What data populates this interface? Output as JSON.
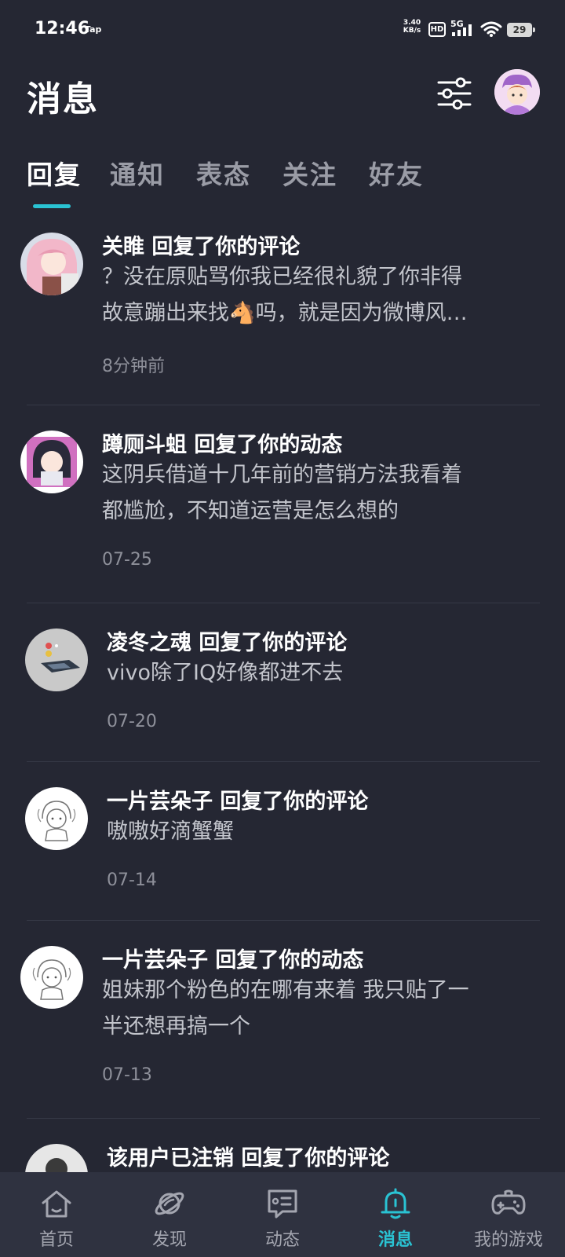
{
  "status_bar": {
    "time": "12:46",
    "tap_label": "Tap",
    "net_speed_top": "3.40",
    "net_speed_bottom": "KB/s",
    "hd_badge": "HD",
    "signal_label": "5G",
    "battery_level": "29"
  },
  "header": {
    "title": "消息",
    "filter_icon": "sliders-icon",
    "avatar_icon": "user-avatar"
  },
  "tabs": [
    {
      "label": "回复",
      "active": true
    },
    {
      "label": "通知",
      "active": false
    },
    {
      "label": "表态",
      "active": false
    },
    {
      "label": "关注",
      "active": false
    },
    {
      "label": "好友",
      "active": false
    }
  ],
  "messages": [
    {
      "user": "关睢",
      "action": "回复了你的评论",
      "lines": [
        "？没在原贴骂你我已经很礼貌了你非得",
        "故意蹦出来找🐴吗，就是因为微博风…"
      ],
      "time": "8分钟前"
    },
    {
      "user": "蹲厕斗蛆",
      "action": "回复了你的动态",
      "lines": [
        "这阴兵借道十几年前的营销方法我看着",
        "都尴尬，不知道运营是怎么想的"
      ],
      "time": "07-25"
    },
    {
      "user": "凌冬之魂",
      "action": "回复了你的评论",
      "lines": [
        "vivo除了IQ好像都进不去"
      ],
      "time": "07-20"
    },
    {
      "user": "一片芸朵子",
      "action": "回复了你的评论",
      "lines": [
        "嗷嗷好滴蟹蟹"
      ],
      "time": "07-14"
    },
    {
      "user": "一片芸朵子",
      "action": "回复了你的动态",
      "lines": [
        "姐妹那个粉色的在哪有来着 我只贴了一",
        "半还想再搞一个"
      ],
      "time": "07-13"
    },
    {
      "user": "该用户已注销",
      "action": "回复了你的评论",
      "lines": [],
      "time": ""
    }
  ],
  "bottom_nav": [
    {
      "label": "首页",
      "icon": "home-icon",
      "active": false
    },
    {
      "label": "发现",
      "icon": "planet-icon",
      "active": false
    },
    {
      "label": "动态",
      "icon": "chat-icon",
      "active": false
    },
    {
      "label": "消息",
      "icon": "bell-icon",
      "active": true
    },
    {
      "label": "我的游戏",
      "icon": "gamepad-icon",
      "active": false
    }
  ],
  "colors": {
    "background": "#252733",
    "accent": "#2ac3d3",
    "nav_background": "#2f3240"
  }
}
